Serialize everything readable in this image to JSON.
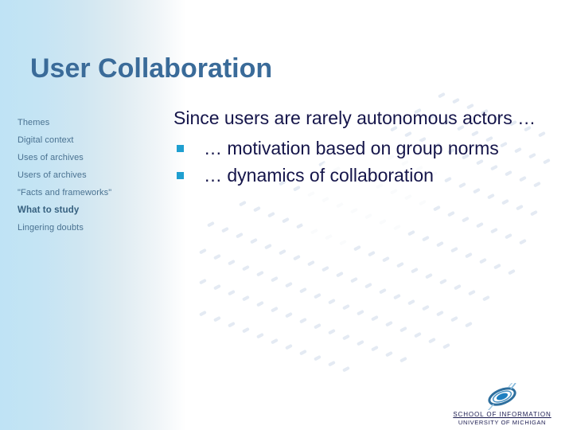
{
  "slide": {
    "title": "User Collaboration",
    "title_color": "#3a6b99",
    "background_accent_color": "#bfe3f5",
    "bullet_color": "#1f9fd0",
    "body_text_color": "#15154a"
  },
  "sidebar": {
    "items": [
      {
        "label": "Themes",
        "current": false
      },
      {
        "label": "Digital context",
        "current": false
      },
      {
        "label": "Uses of archives",
        "current": false
      },
      {
        "label": "Users of archives",
        "current": false
      },
      {
        "label": "\"Facts and frameworks\"",
        "current": false
      },
      {
        "label": "What to study",
        "current": true
      },
      {
        "label": "Lingering doubts",
        "current": false
      }
    ]
  },
  "content": {
    "lead": "Since users are rarely autonomous actors …",
    "bullets": [
      "…  motivation based on group norms",
      "…  dynamics of collaboration"
    ]
  },
  "footer": {
    "logo_icon": "swirl-logo-icon",
    "line1": "SCHOOL OF INFORMATION",
    "line2": "UNIVERSITY OF MICHIGAN"
  }
}
